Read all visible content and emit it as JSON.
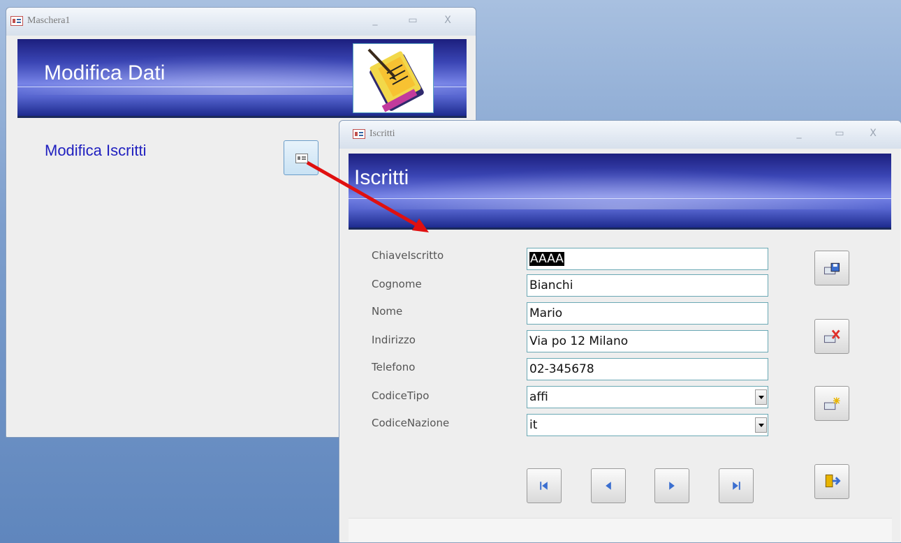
{
  "window1": {
    "title": "Maschera1",
    "banner_title": "Modifica Dati",
    "label": "Modifica Iscritti"
  },
  "window2": {
    "title": "Iscritti",
    "banner_title": "Iscritti",
    "fields": [
      {
        "label": "ChiaveIscritto",
        "value": "AAAA"
      },
      {
        "label": "Cognome",
        "value": "Bianchi"
      },
      {
        "label": "Nome",
        "value": "Mario"
      },
      {
        "label": "Indirizzo",
        "value": "Via po 12 Milano"
      },
      {
        "label": "Telefono",
        "value": "02-345678"
      },
      {
        "label": "CodiceTipo",
        "value": "affi"
      },
      {
        "label": "CodiceNazione",
        "value": "it"
      }
    ]
  },
  "window_controls": {
    "minimize": "_",
    "maximize": "▭",
    "close": "X"
  },
  "colors": {
    "accent_arrow": "#e01010",
    "banner_dark": "#1c1f7e",
    "nav_glyph": "#3b6fd0"
  }
}
